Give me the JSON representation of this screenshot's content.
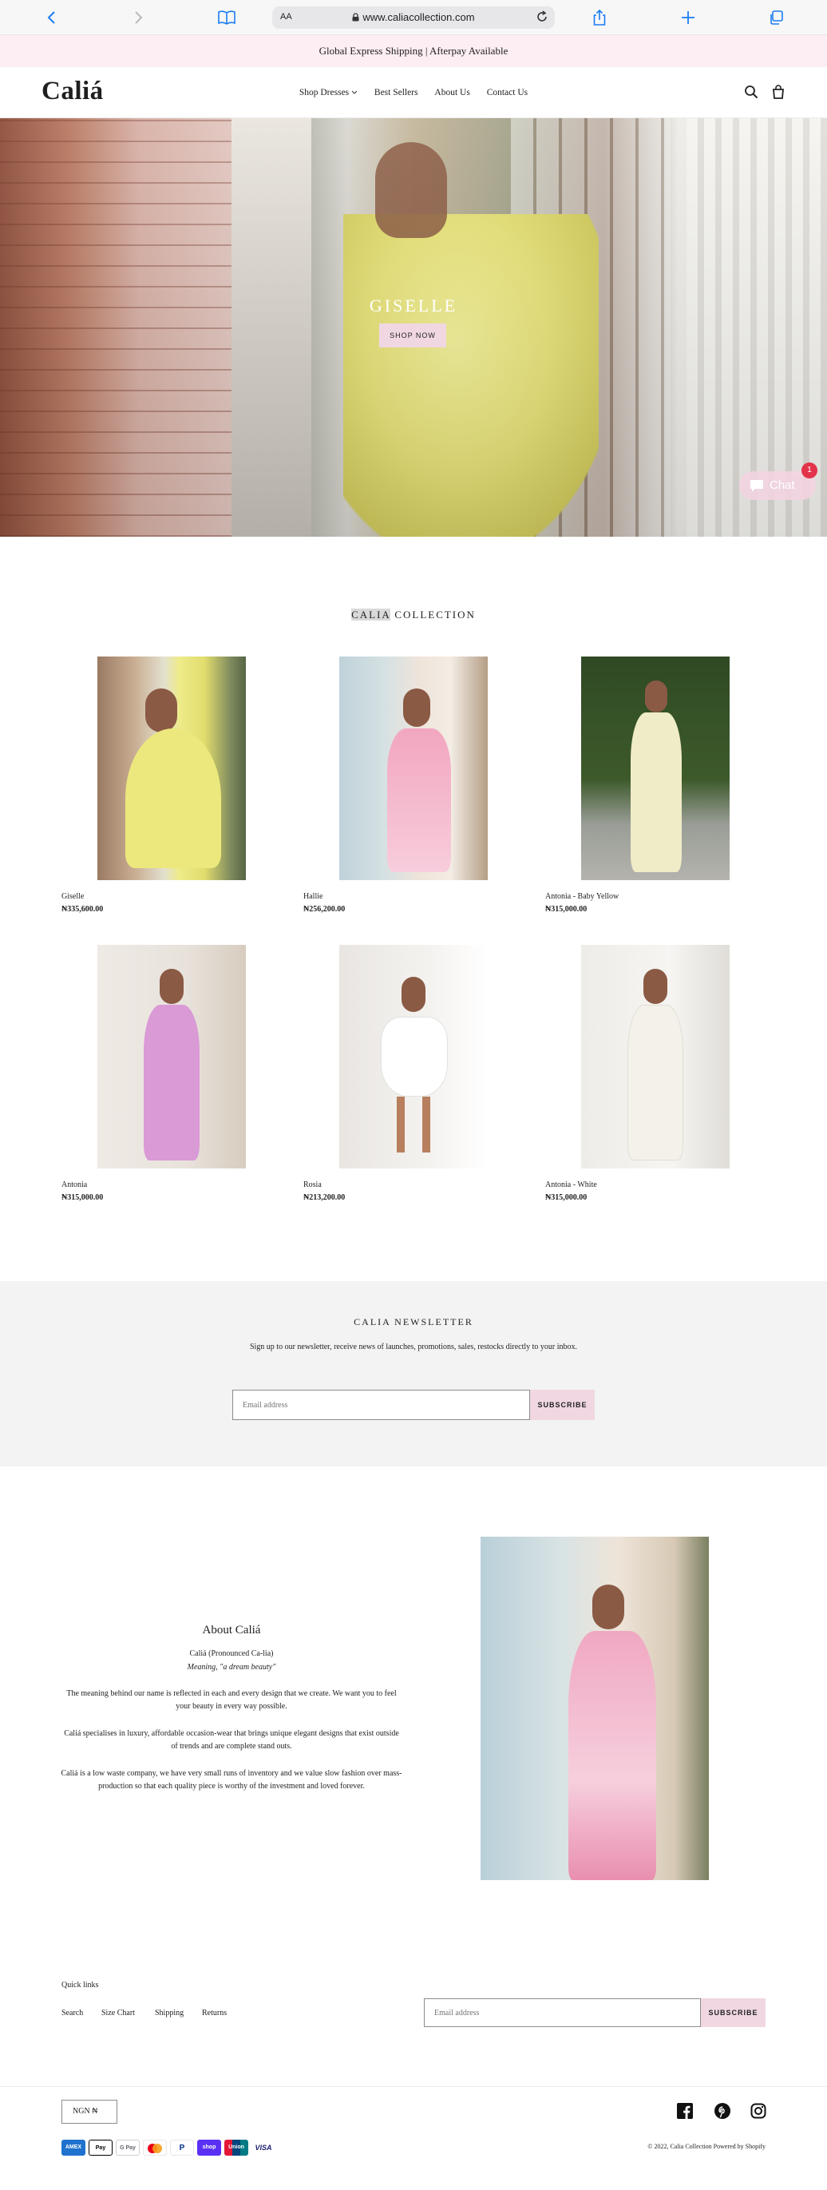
{
  "browser": {
    "url": "www.caliacollection.com",
    "aa_label": "AA"
  },
  "announcement": "Global Express Shipping | Afterpay Available",
  "header": {
    "logo": "Caliá",
    "nav": [
      "Shop Dresses",
      "Best Sellers",
      "About Us",
      "Contact Us"
    ]
  },
  "hero": {
    "title": "GISELLE",
    "button": "SHOP NOW"
  },
  "chat": {
    "label": "Chat",
    "badge": "1"
  },
  "collection": {
    "title_highlight": "CALIA",
    "title_rest": "COLLECTION",
    "products": [
      {
        "name": "Giselle",
        "price": "₦335,600.00"
      },
      {
        "name": "Hallie",
        "price": "₦256,200.00"
      },
      {
        "name": "Antonia - Baby Yellow",
        "price": "₦315,000.00"
      },
      {
        "name": "Antonia",
        "price": "₦315,000.00"
      },
      {
        "name": "Rosia",
        "price": "₦213,200.00"
      },
      {
        "name": "Antonia - White",
        "price": "₦315,000.00"
      }
    ]
  },
  "newsletter": {
    "title": "CALIA NEWSLETTER",
    "text": "Sign up to our newsletter, receive news of launches, promotions, sales, restocks directly to your inbox.",
    "placeholder": "Email address",
    "button": "SUBSCRIBE"
  },
  "about": {
    "title": "About Caliá",
    "pronounced": "Caliá (Pronounced Ca-lia)",
    "meaning": "Meaning, \"a dream beauty\"",
    "para1_l1": "The meaning behind our name is reflected in each and every design that we create. We want you to feel",
    "para1_l2": "your beauty in every way possible.",
    "para2_l1": "Caliá specialises in luxury, affordable occasion-wear that brings unique elegant designs that exist outside",
    "para2_l2": "of trends and are complete stand outs.",
    "para3_l1": "Caliá is a low waste company, we have very small runs of inventory and we value slow fashion over mass-",
    "para3_l2": "production so that each quality piece is worthy of the investment and loved forever."
  },
  "footer": {
    "quick_links_label": "Quick links",
    "links": [
      "Search",
      "Size Chart",
      "Shipping",
      "Returns"
    ],
    "email_placeholder": "Email address",
    "subscribe": "SUBSCRIBE",
    "currency": "NGN ₦",
    "payments": [
      "AMEX",
      "Pay",
      "G Pay",
      "MC",
      "P",
      "shop",
      "Union",
      "VISA"
    ],
    "copyright": "© 2022, Calia Collection Powered by Shopify"
  },
  "colors": {
    "accent_pink": "#f0d7e2",
    "announce_bg": "#fdeef3",
    "ios_blue": "#1a7cf2"
  }
}
